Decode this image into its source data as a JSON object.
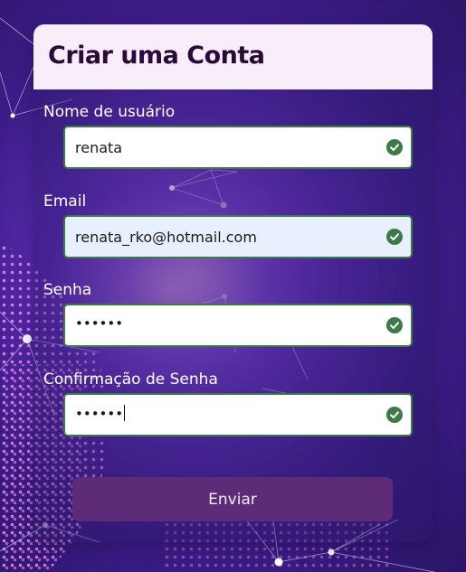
{
  "form": {
    "title": "Criar uma Conta",
    "fields": [
      {
        "label": "Nome de usuário",
        "value": "renata",
        "status": "valid"
      },
      {
        "label": "Email",
        "value": "renata_rko@hotmail.com",
        "status": "valid"
      },
      {
        "label": "Senha",
        "value": "••••••",
        "status": "valid"
      },
      {
        "label": "Confirmação de Senha",
        "value": "••••••",
        "status": "valid"
      }
    ],
    "submit_label": "Enviar"
  },
  "colors": {
    "header_bg": "#f8eef9",
    "title": "#2a0a38",
    "valid_border": "#3d7a46",
    "valid_icon": "#3d7a46",
    "button_bg": "#5e2b78",
    "autofill_bg": "#e8f0fe"
  },
  "icons": {
    "status": "check-circle-icon"
  }
}
